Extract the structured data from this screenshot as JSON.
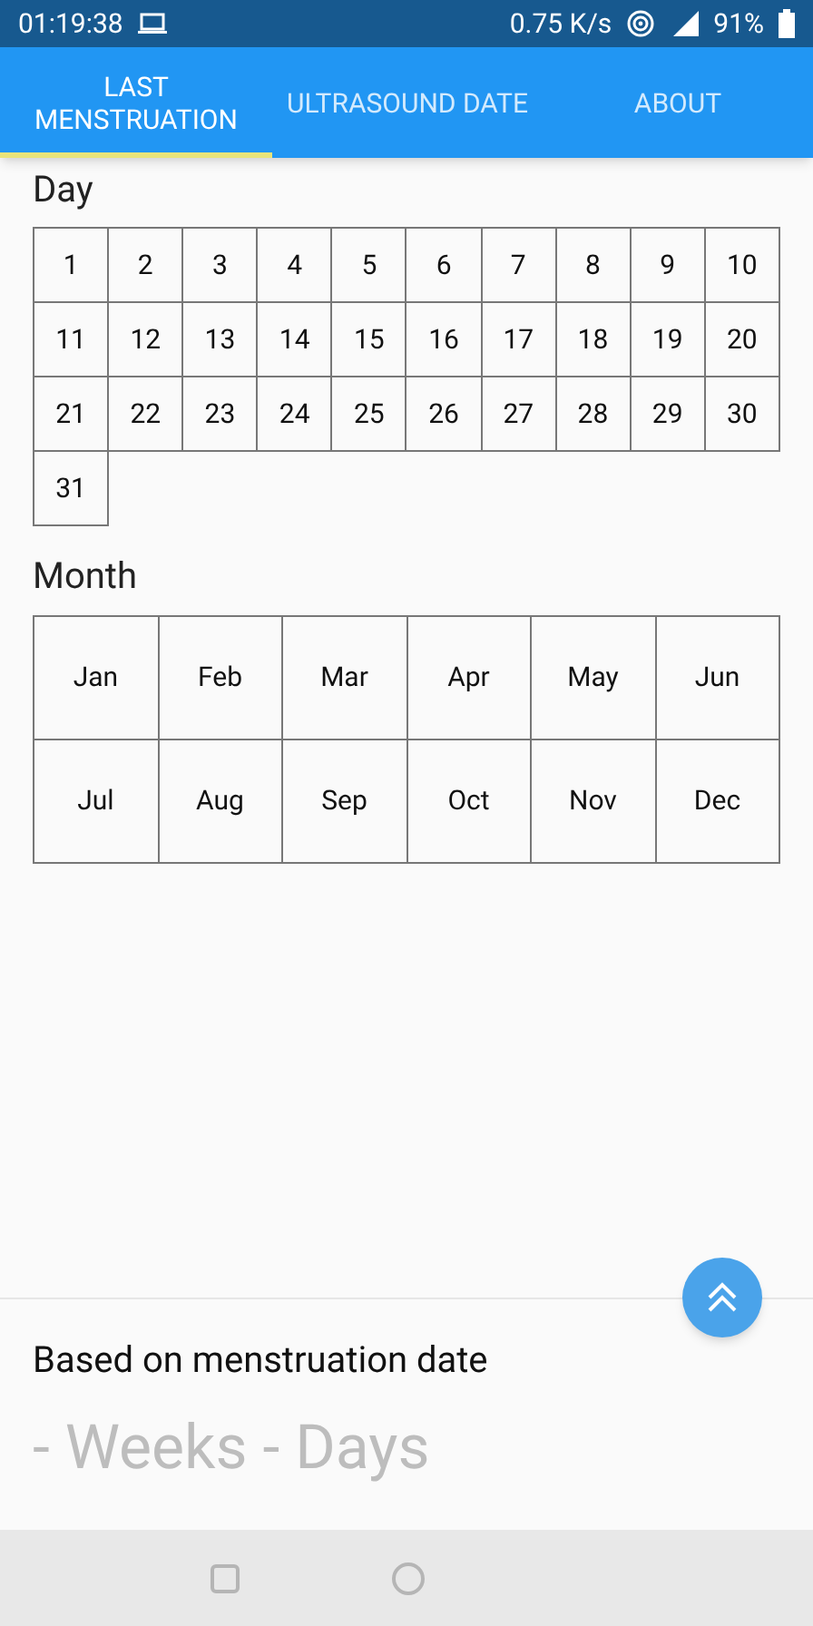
{
  "status_bar": {
    "time": "01:19:38",
    "speed": "0.75 K/s",
    "battery": "91%"
  },
  "tabs": [
    {
      "label": "LAST MENSTRUATION",
      "selected": true
    },
    {
      "label": "ULTRASOUND DATE",
      "selected": false
    },
    {
      "label": "ABOUT",
      "selected": false
    }
  ],
  "day_section": {
    "title": "Day",
    "days": [
      "1",
      "2",
      "3",
      "4",
      "5",
      "6",
      "7",
      "8",
      "9",
      "10",
      "11",
      "12",
      "13",
      "14",
      "15",
      "16",
      "17",
      "18",
      "19",
      "20",
      "21",
      "22",
      "23",
      "24",
      "25",
      "26",
      "27",
      "28",
      "29",
      "30",
      "31"
    ]
  },
  "month_section": {
    "title": "Month",
    "months": [
      "Jan",
      "Feb",
      "Mar",
      "Apr",
      "May",
      "Jun",
      "Jul",
      "Aug",
      "Sep",
      "Oct",
      "Nov",
      "Dec"
    ]
  },
  "result": {
    "caption": "Based on menstruation date",
    "value": "- Weeks - Days"
  }
}
